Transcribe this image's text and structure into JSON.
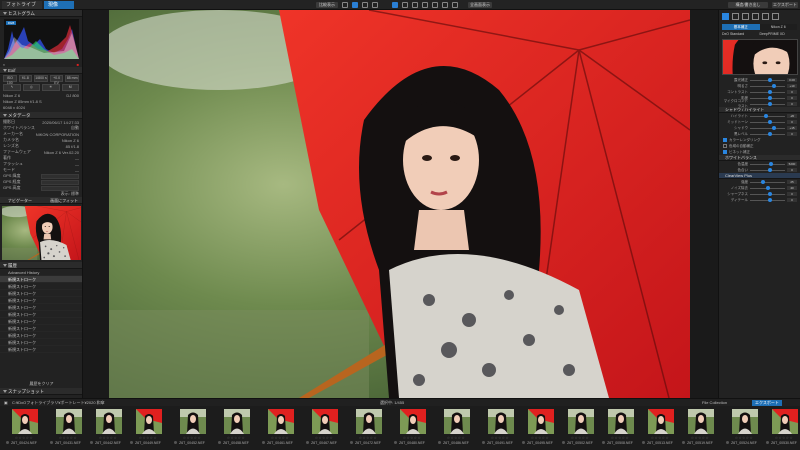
{
  "top_tabs": [
    {
      "label": "フォトライブラリ"
    },
    {
      "label": "現像"
    }
  ],
  "top_buttons": {
    "compare": "比較表示",
    "fullscreen": "全画面表示",
    "export": "エクスポート",
    "tools": "構造/書き出し"
  },
  "left_panel": {
    "histogram_title": "ヒストグラム",
    "exif_title": "Exif",
    "exif_btns": [
      "ISO 100",
      "f/1.8",
      "1/800 s",
      "+0.0 EV",
      "85 mm"
    ],
    "camera_rows": [
      {
        "k": "Nikon Z 6",
        "v": "DJ 800"
      },
      {
        "k": "Nikon Z 85mm f/1.8 S",
        "v": ""
      },
      {
        "k": "6048 x 4024",
        "v": ""
      }
    ],
    "meta_title": "メタデータ",
    "meta_rows": [
      {
        "k": "撮影日",
        "v": "2020/06/17 14:27:33"
      },
      {
        "k": "ホワイトバランス",
        "v": "自動"
      },
      {
        "k": "メーカー名",
        "v": "NIKON CORPORATION"
      },
      {
        "k": "カメラ名",
        "v": "Nikon Z 6"
      },
      {
        "k": "レンズ名",
        "v": "85 f/1.8"
      },
      {
        "k": "ファームウェア",
        "v": "Nikon Z 6 Ver.02.20"
      },
      {
        "k": "著作",
        "v": "—"
      },
      {
        "k": "フラッシュ",
        "v": "—"
      },
      {
        "k": "モード",
        "v": "—"
      }
    ],
    "gps_rows": [
      "GPS 緯度",
      "GPS 経度",
      "GPS 高度"
    ],
    "gps_footer": "表示: 標準",
    "navigator_title": "ナビゲーター",
    "zoom_label": "画面にフィット",
    "history_title": "履歴",
    "history_items": [
      "Advanced History",
      "新規ストローク",
      "新規ストローク",
      "新規ストローク",
      "新規ストローク",
      "新規ストローク",
      "新規ストローク",
      "新規ストローク",
      "新規ストローク",
      "新規ストローク",
      "新規ストローク",
      "新規ストローク"
    ],
    "history_clear": "履歴をクリア",
    "snapshot_title": "スナップショット"
  },
  "right_panel": {
    "tab_a": "基本補正",
    "tab_b": "Nikon Z 6",
    "profile": "DxO Standard",
    "profile2": "DeepPRIME XD",
    "sliders_top": [
      {
        "label": "露光補正",
        "val": "0.00"
      },
      {
        "label": "明るさ",
        "val": "+10"
      },
      {
        "label": "コントラスト",
        "val": "0"
      },
      {
        "label": "彩度",
        "val": "0"
      },
      {
        "label": "マイクロコントラスト",
        "val": "0"
      }
    ],
    "section2": "シャドウ / ハイライト",
    "sliders_mid": [
      {
        "label": "ハイライト",
        "val": "-20"
      },
      {
        "label": "ミッドトーン",
        "val": "0"
      },
      {
        "label": "シャドウ",
        "val": "+15"
      },
      {
        "label": "黒レベル",
        "val": "0"
      }
    ],
    "checks": [
      {
        "label": "カラーレンダリング",
        "on": true
      },
      {
        "label": "色域の自動補正",
        "on": false
      },
      {
        "label": "ビネット補正",
        "on": true
      }
    ],
    "section3": "ホワイトバランス",
    "sliders_wb": [
      {
        "label": "色温度",
        "val": "5200"
      },
      {
        "label": "色合い",
        "val": "0"
      }
    ],
    "section4": "ClearView Plus",
    "sliders_bot": [
      {
        "label": "強度",
        "val": "25"
      },
      {
        "label": "ノイズ除去",
        "val": "40"
      },
      {
        "label": "シャープネス",
        "val": "0"
      },
      {
        "label": "ディテール",
        "val": "0"
      }
    ]
  },
  "filmstrip": {
    "path": "C:¥DxOフォトライブラリ¥ポートレート¥2020 和傘",
    "count": "選択中: 1/455",
    "collection_label": "File Collection",
    "export_label": "エクスポート",
    "thumbs": [
      {
        "name": "Z6T_00424.NEF"
      },
      {
        "name": "Z6T_00431.NEF"
      },
      {
        "name": "Z6T_00442.NEF"
      },
      {
        "name": "Z6T_00449.NEF"
      },
      {
        "name": "Z6T_00452.NEF"
      },
      {
        "name": "Z6T_00458.NEF"
      },
      {
        "name": "Z6T_00461.NEF"
      },
      {
        "name": "Z6T_00467.NEF"
      },
      {
        "name": "Z6T_00472.NEF"
      },
      {
        "name": "Z6T_00480.NEF"
      },
      {
        "name": "Z6T_00486.NEF"
      },
      {
        "name": "Z6T_00491.NEF"
      },
      {
        "name": "Z6T_00495.NEF"
      },
      {
        "name": "Z6T_00502.NEF"
      },
      {
        "name": "Z6T_00508.NEF"
      },
      {
        "name": "Z6T_00513.NEF"
      },
      {
        "name": "Z6T_00519.NEF"
      },
      {
        "name": "Z6T_00524.NEF"
      },
      {
        "name": "Z6T_00530.NEF"
      },
      {
        "name": "Z6T_00536.NEF"
      }
    ]
  },
  "colors": {
    "accent": "#2a86e0",
    "umbrella": "#e0201f",
    "bg_green": "#5f7d45"
  }
}
